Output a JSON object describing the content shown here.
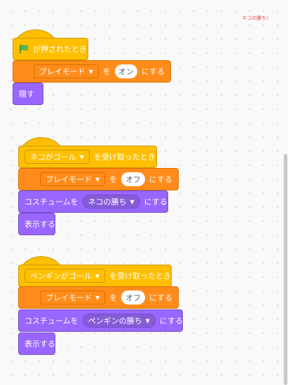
{
  "corner_note": "ネコの勝ち！",
  "colors": {
    "events": "#ffbf00",
    "variables": "#ff8c1a",
    "looks": "#9966ff",
    "flag": "#4cbf56"
  },
  "icons": {
    "flag": "green-flag-icon",
    "caret": "dropdown-caret-icon"
  },
  "scripts": [
    {
      "hat": {
        "suffix": "が押されたとき"
      },
      "set_var": {
        "variable": "プレイモード",
        "to": "を",
        "value": "オン",
        "suffix": "にする"
      },
      "hide": "隠す"
    },
    {
      "hat": {
        "message": "ネコがゴール",
        "suffix": "を受け取ったとき"
      },
      "set_var": {
        "variable": "プレイモード",
        "to": "を",
        "value": "オフ",
        "suffix": "にする"
      },
      "costume": {
        "prefix": "コスチュームを",
        "value": "ネコの勝ち",
        "suffix": "にする"
      },
      "show": "表示する"
    },
    {
      "hat": {
        "message": "ペンギンがゴール",
        "suffix": "を受け取ったとき"
      },
      "set_var": {
        "variable": "プレイモード",
        "to": "を",
        "value": "オフ",
        "suffix": "にする"
      },
      "costume": {
        "prefix": "コスチュームを",
        "value": "ペンギンの勝ち",
        "suffix": "にする"
      },
      "show": "表示する"
    }
  ]
}
